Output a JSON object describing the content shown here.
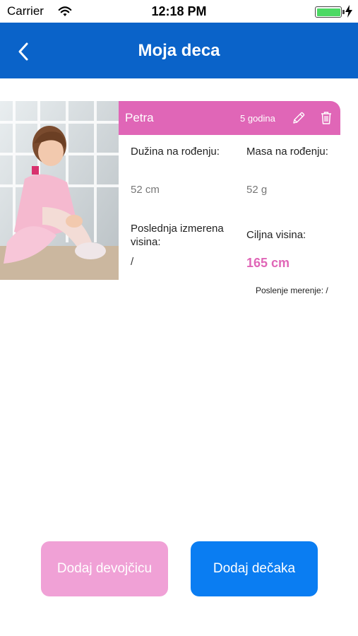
{
  "status_bar": {
    "carrier": "Carrier",
    "time": "12:18 PM"
  },
  "nav": {
    "title": "Moja deca",
    "back_icon": "chevron-left-icon"
  },
  "child": {
    "name": "Petra",
    "age": "5 godina",
    "birth_length_label": "Dužina na rođenju:",
    "birth_length_value": "52 cm",
    "birth_mass_label": "Masa na rođenju:",
    "birth_mass_value": "52 g",
    "last_height_label": "Poslednja izmerena visina:",
    "last_height_value": "/",
    "target_height_label": "Ciljna visina:",
    "target_height_value": "165 cm",
    "last_measurement": "Poslenje merenje: /",
    "icons": {
      "edit": "pencil-icon",
      "delete": "trash-icon"
    }
  },
  "buttons": {
    "add_girl": "Dodaj devojčicu",
    "add_boy": "Dodaj dečaka"
  },
  "colors": {
    "nav_blue": "#0a63c9",
    "pink": "#e066b7",
    "pink_light": "#f0a1d6",
    "button_blue": "#0a7df2"
  }
}
